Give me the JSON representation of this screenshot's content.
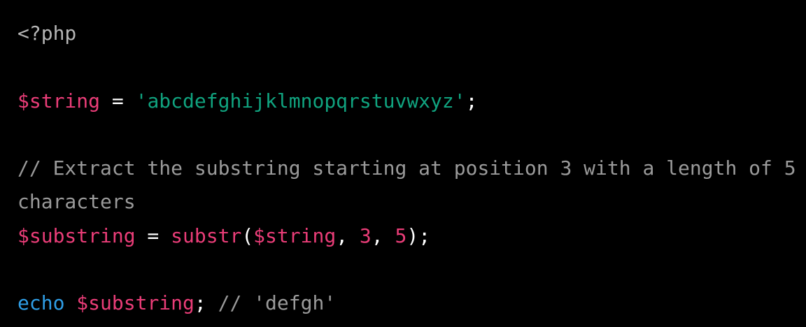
{
  "code": {
    "line1": {
      "tag": "<?php"
    },
    "line3": {
      "var": "$string",
      "op": " = ",
      "str": "'abcdefghijklmnopqrstuvwxyz'",
      "punct": ";"
    },
    "line5": {
      "comment": "// Extract the substring starting at position 3 with a length of 5"
    },
    "line6": {
      "comment": "characters"
    },
    "line7": {
      "var": "$substring",
      "op": " = ",
      "func": "substr",
      "paren_open": "(",
      "arg_var": "$string",
      "sep1": ", ",
      "num1": "3",
      "sep2": ", ",
      "num2": "5",
      "paren_close": ");"
    },
    "line9": {
      "kw": "echo",
      "space": " ",
      "var": "$substring",
      "punct": ";",
      "comment": " // 'defgh'"
    }
  },
  "colors": {
    "background": "#000000",
    "variable": "#ea3d78",
    "string": "#10a37f",
    "comment": "#9a9a9a",
    "keyword": "#2f9ee6",
    "default": "#ffffff"
  }
}
